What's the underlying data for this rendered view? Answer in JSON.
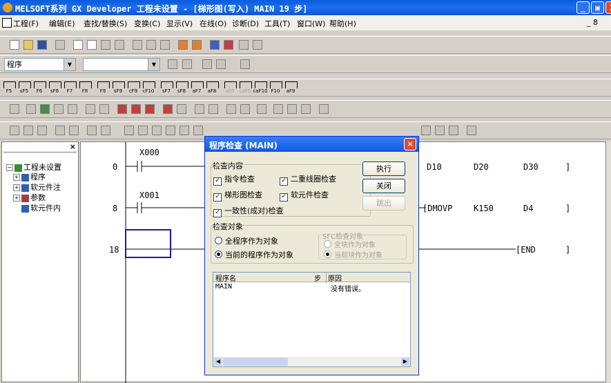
{
  "window": {
    "title": "MELSOFT系列 GX Developer 工程未设置 - [梯形图(写入)    MAIN   19 步]",
    "minimize": "_",
    "restore": "▣",
    "close": "X"
  },
  "menu": [
    "工程(F)",
    "编辑(E)",
    "查找/替换(S)",
    "变换(C)",
    "显示(V)",
    "在线(O)",
    "诊断(D)",
    "工具(T)",
    "窗口(W)",
    "帮助(H)"
  ],
  "menu_right": "_ 8",
  "toolbar": {
    "program_combo": "程序",
    "combo2": ""
  },
  "fkeys": [
    "F5",
    "sF5",
    "F6",
    "sF6",
    "F7",
    "F8",
    "F9",
    "sF9",
    "cF9",
    "cF10",
    "sF7",
    "sF8",
    "aF7",
    "aF8",
    "aF5",
    "caF5",
    "caF10",
    "F10",
    "aF9"
  ],
  "tree": {
    "close": "×",
    "items": [
      "工程未设置",
      "程序",
      "软元件注",
      "参数",
      "软元件内"
    ]
  },
  "ladder": {
    "steps": [
      "0",
      "8",
      "18"
    ],
    "contacts": [
      "X000",
      "X001"
    ],
    "row1": [
      "D10",
      "D20",
      "D30"
    ],
    "row2": [
      "[DMOVP",
      "K150",
      "D4"
    ],
    "row3": "[END",
    "bracket": "]"
  },
  "dialog": {
    "title": "程序检查 (MAIN)",
    "group1": "检查内容",
    "checks": [
      "指令检查",
      "二重线圈检查",
      "梯形图检查",
      "软元件检查",
      "一致性(成对)检查"
    ],
    "buttons": [
      "执行",
      "关闭",
      "跳出"
    ],
    "group2": "检查对象",
    "radios": [
      "全程序作为对象",
      "当前的程序作为对象"
    ],
    "sfc_group": "SFC检查对象",
    "sfc_radios": [
      "全块作为对象",
      "当前块作为对象"
    ],
    "list_headers": [
      "程序名",
      "步",
      "原因"
    ],
    "list_rows": [
      {
        "program": "MAIN",
        "step": "",
        "reason": "没有错误。"
      }
    ]
  }
}
